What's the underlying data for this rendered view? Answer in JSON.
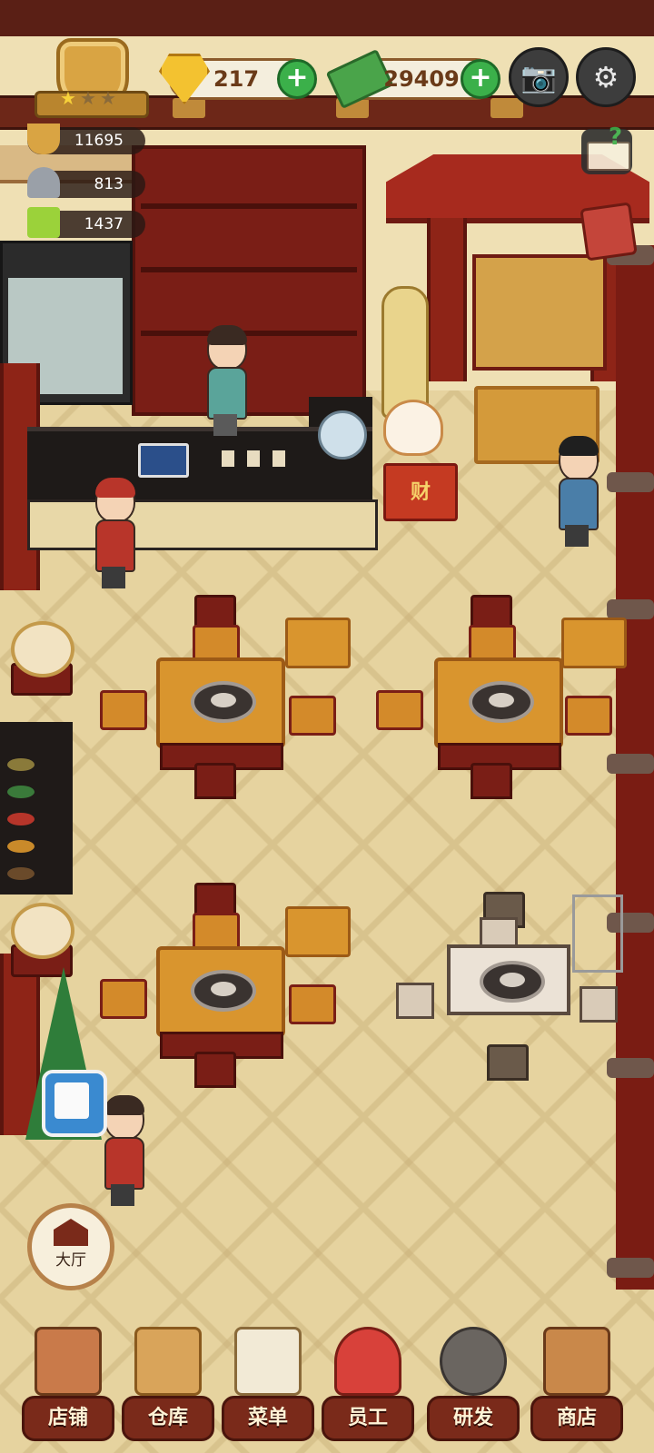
{
  "hud": {
    "gems": "217",
    "cash": "29409",
    "stats": [
      "11695",
      "813",
      "1437"
    ],
    "stars_filled": 1,
    "stars_total": 3
  },
  "buttons": {
    "hall_label": "大厅"
  },
  "decor": {
    "cash_box_text": "财"
  },
  "nav": [
    {
      "label": "店铺",
      "icon": "shop-building-icon"
    },
    {
      "label": "仓库",
      "icon": "warehouse-boxes-icon"
    },
    {
      "label": "菜单",
      "icon": "menu-clipboard-icon"
    },
    {
      "label": "员工",
      "icon": "staff-chef-icon"
    },
    {
      "label": "研发",
      "icon": "research-wok-icon"
    },
    {
      "label": "商店",
      "icon": "store-stall-icon"
    }
  ],
  "colors": {
    "accent_green": "#3bb04a",
    "wood_red": "#7a1e16",
    "gold": "#d9a443",
    "floor": "#e6d39f"
  }
}
